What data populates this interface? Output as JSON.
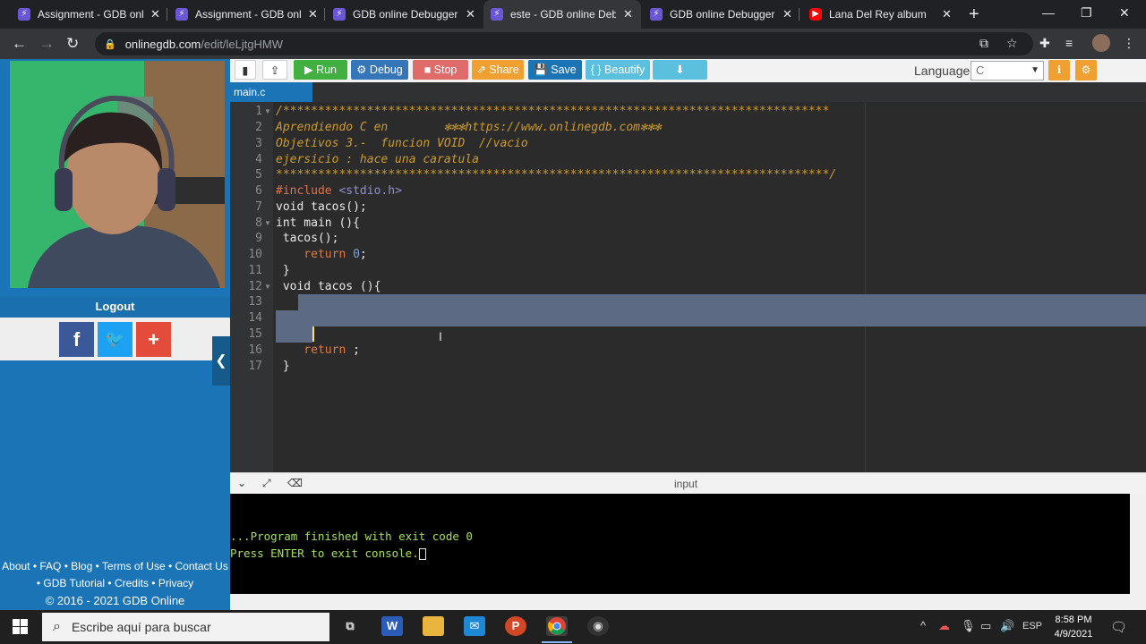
{
  "browser": {
    "tabs": [
      {
        "title": "Assignment - GDB onlin",
        "icon": "gdb-icon"
      },
      {
        "title": "Assignment - GDB onlin",
        "icon": "gdb-icon"
      },
      {
        "title": "GDB online Debugger |",
        "icon": "gdb-icon"
      },
      {
        "title": "este - GDB online Debu",
        "icon": "gdb-icon",
        "active": true
      },
      {
        "title": "GDB online Debugger |",
        "icon": "gdb-icon"
      },
      {
        "title": "Lana Del Rey album",
        "icon": "youtube-icon"
      }
    ],
    "url_host": "onlinegdb.com",
    "url_path": "/edit/leLjtgHMW"
  },
  "sidebar": {
    "logout_label": "Logout",
    "footer_line1": "About • FAQ • Blog • Terms of Use • Contact Us",
    "footer_line2": "• GDB Tutorial • Credits • Privacy",
    "footer_line3": "© 2016 - 2021 GDB Online"
  },
  "toolbar": {
    "run_label": "Run",
    "debug_label": "Debug",
    "stop_label": "Stop",
    "share_label": "Share",
    "save_label": "Save",
    "beautify_label": "{ } Beautify",
    "language_label": "Language",
    "language_value": "C"
  },
  "editor": {
    "file_tab": "main.c",
    "line_numbers": [
      "1",
      "2",
      "3",
      "4",
      "5",
      "6",
      "7",
      "8",
      "9",
      "10",
      "11",
      "12",
      "13",
      "14",
      "15",
      "16",
      "17"
    ],
    "lines": {
      "l1": "/******************************************************************************",
      "l2": "Aprendiendo C en        ✻✻✻https://www.onlinegdb.com✻✻✻",
      "l3": "Objetivos 3.-  funcion VOID  //vacio",
      "l4": "ejersicio : hace una caratula",
      "l5": "*******************************************************************************/",
      "l6_pp": "#include ",
      "l6_hdr": "<stdio.h>",
      "l7": "void tacos();",
      "l8": "int main (){",
      "l9": " tacos();",
      "l10_kw": "    return ",
      "l10_num": "0",
      "l10_end": ";",
      "l11": " }",
      "l12": " void tacos (){",
      "l16_kw": "    return ",
      "l16_end": ";",
      "l17": " }"
    }
  },
  "console": {
    "label": "input",
    "line1": "...Program finished with exit code 0",
    "line2": "Press ENTER to exit console."
  },
  "taskbar": {
    "search_placeholder": "Escribe aquí para buscar",
    "lang": "ESP",
    "time": "8:58 PM",
    "date": "4/9/2021"
  }
}
